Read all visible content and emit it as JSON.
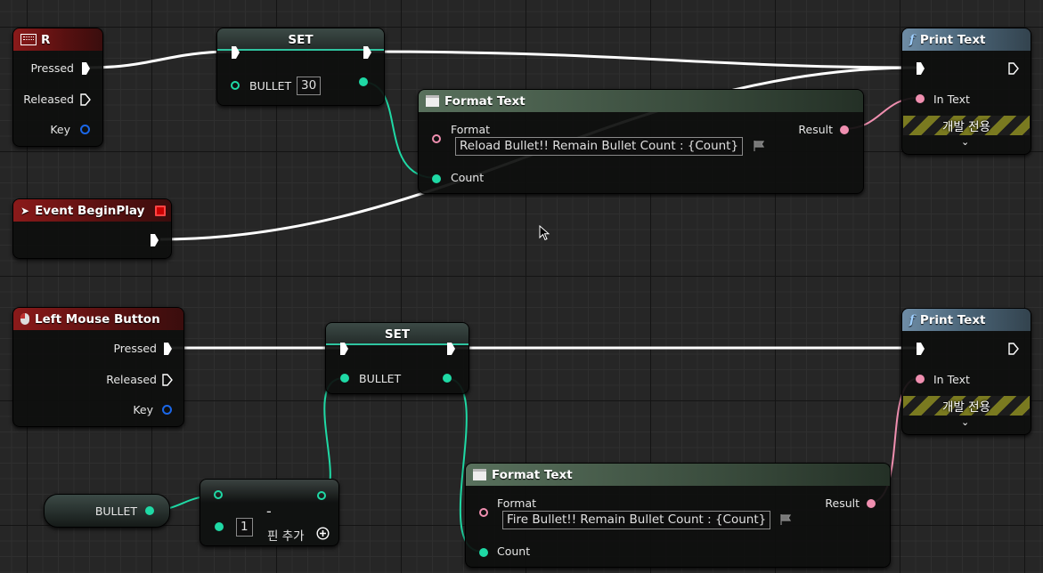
{
  "nodes": {
    "r_key": {
      "title": "R",
      "pressed": "Pressed",
      "released": "Released",
      "key": "Key"
    },
    "set_top": {
      "title": "SET",
      "var": "BULLET",
      "value": "30"
    },
    "print_top": {
      "title": "Print Text",
      "in_text": "In Text",
      "dev_only": "개발 전용"
    },
    "format_top": {
      "title": "Format Text",
      "format": "Format",
      "format_value": "Reload Bullet!! Remain Bullet Count : {Count}",
      "result": "Result",
      "count": "Count"
    },
    "begin_play": {
      "title": "Event BeginPlay"
    },
    "lmb": {
      "title": "Left Mouse Button",
      "pressed": "Pressed",
      "released": "Released",
      "key": "Key"
    },
    "set_bottom": {
      "title": "SET",
      "var": "BULLET"
    },
    "print_bottom": {
      "title": "Print Text",
      "in_text": "In Text",
      "dev_only": "개발 전용"
    },
    "format_bottom": {
      "title": "Format Text",
      "format": "Format",
      "format_value": "Fire Bullet!! Remain Bullet Count : {Count}",
      "result": "Result",
      "count": "Count"
    },
    "get_bullet": {
      "var": "BULLET"
    },
    "subtract": {
      "op": "-",
      "value": "1",
      "add_pin": "핀 추가"
    }
  },
  "colors": {
    "exec": "#ffffff",
    "integer": "#1fd9a5",
    "text": "#f08fb0",
    "struct": "#1b67e8",
    "event_header": "#8b1a1a",
    "function_header": "#6e8ca5",
    "pure_header": "#58705c"
  },
  "icons": {
    "r_key": "keyboard-icon",
    "begin_play": "event-icon",
    "lmb": "mouse-icon",
    "print": "function-icon",
    "format": "format-text-icon",
    "flag": "localize-flag-icon",
    "add_pin": "add-pin-icon",
    "chevron": "chevron-down-icon"
  }
}
